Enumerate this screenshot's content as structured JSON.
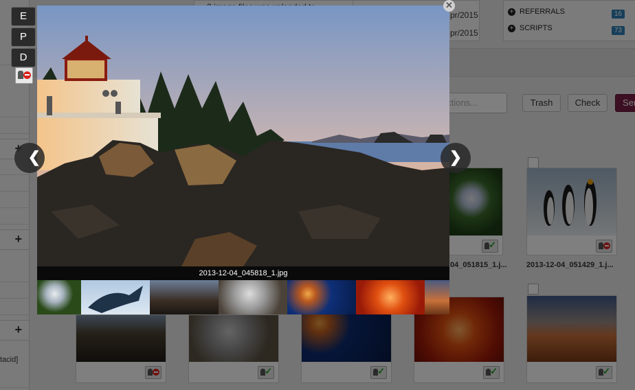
{
  "side_buttons": {
    "e": "E",
    "p": "P",
    "d": "D"
  },
  "left_panel": {
    "partial_text": "tacid]"
  },
  "top_table": {
    "row1": "2 image files was uploaded to",
    "row2_date": "pr/2015",
    "row3_date": "pr/2015"
  },
  "right_panel": {
    "items": [
      {
        "label": "REFERRALS",
        "count": "16"
      },
      {
        "label": "SCRIPTS",
        "count": "73"
      }
    ]
  },
  "toolbar": {
    "search_placeholder": "ch Actions...",
    "trash_label": "Trash",
    "check_label": "Check",
    "send_label": "Sen"
  },
  "gallery": {
    "captions": {
      "c1": "04_051815_1.j...",
      "c2": "2013-12-04_051429_1.j..."
    }
  },
  "lightbox": {
    "filename": "2013-12-04_045818_1.jpg",
    "close_symbol": "✕",
    "prev_symbol": "❮",
    "next_symbol": "❯"
  },
  "colors": {
    "accent_dark": "#7a1f45",
    "badge_blue": "#2f7fb5",
    "ok_green": "#1e9a1e",
    "blocked_red": "#d8231c"
  },
  "icons": [
    "plus-icon",
    "user-check-icon",
    "user-blocked-icon",
    "close-icon",
    "chevron-left-icon",
    "chevron-right-icon"
  ]
}
